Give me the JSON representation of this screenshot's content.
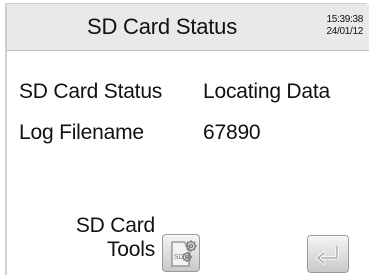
{
  "header": {
    "title": "SD Card Status",
    "time": "15:39:38",
    "date": "24/01/12"
  },
  "status_rows": [
    {
      "label": "SD Card Status",
      "value": "Locating Data"
    },
    {
      "label": "Log Filename",
      "value": "67890"
    }
  ],
  "tools": {
    "label_line1": "SD Card",
    "label_line2": "Tools",
    "icon": "sd-card-gear-icon",
    "icon_text": "SD"
  },
  "back": {
    "icon": "return-arrow-icon"
  },
  "colors": {
    "titlebar_bg": "#e9e9e9",
    "text": "#111111",
    "button_bg": "#d8d8d8"
  }
}
